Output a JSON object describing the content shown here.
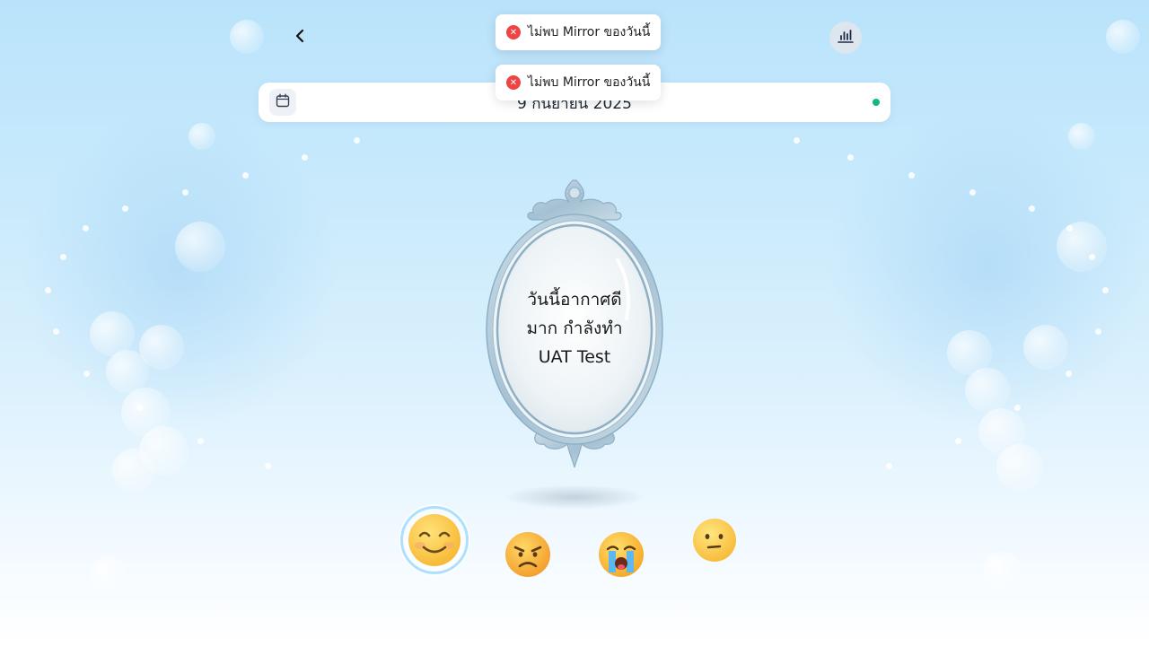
{
  "header": {
    "back_icon": "chevron-left-icon",
    "stats_icon": "bar-chart-icon"
  },
  "date_bar": {
    "calendar_icon": "calendar-icon",
    "date": "9 กันยายน 2025",
    "status_color": "#10b981"
  },
  "toasts": [
    {
      "icon": "error-icon",
      "message": "ไม่พบ Mirror ของวันนี้"
    },
    {
      "icon": "error-icon",
      "message": "ไม่พบ Mirror ของวันนี้"
    }
  ],
  "mirror": {
    "line1": "วันนี้อากาศดี",
    "line2": "มาก กำลังทำ",
    "line3": "UAT Test"
  },
  "moods": [
    {
      "name": "happy",
      "selected": true
    },
    {
      "name": "angry",
      "selected": false
    },
    {
      "name": "crying",
      "selected": false
    },
    {
      "name": "neutral",
      "selected": false
    }
  ],
  "colors": {
    "accent": "#aee0fb",
    "error": "#ef4444",
    "mirror_frame": "#9fbdd0"
  }
}
